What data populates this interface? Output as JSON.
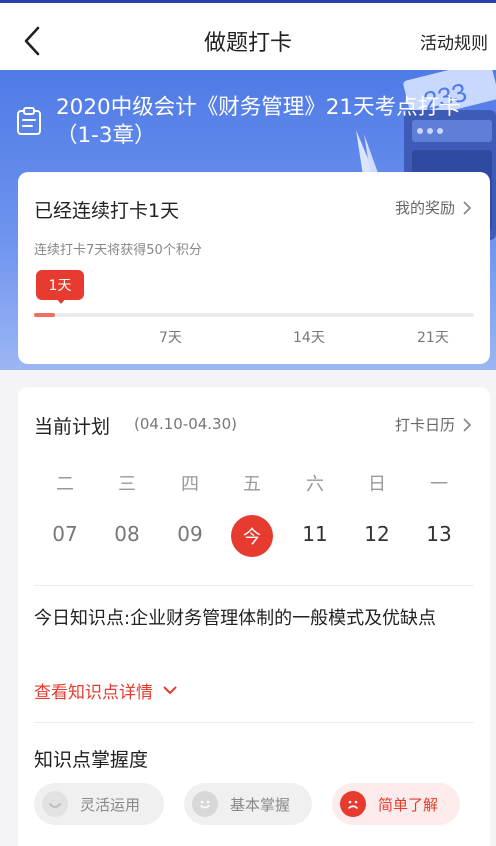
{
  "nav": {
    "title": "做题打卡",
    "rules_label": "活动规则"
  },
  "hero": {
    "title": "2020中级会计《财务管理》21天考点打卡（1-3章）",
    "decor_text": "233"
  },
  "streak": {
    "title": "已经连续打卡1天",
    "reward_label": "我的奖励",
    "subtitle": "连续打卡7天将获得50个积分",
    "badge": "1天",
    "progress_fraction": 0.048,
    "ticks": [
      "7天",
      "14天",
      "21天"
    ]
  },
  "plan": {
    "title": "当前计划",
    "range": "(04.10-04.30)",
    "calendar_label": "打卡日历",
    "weekdays": [
      "二",
      "三",
      "四",
      "五",
      "六",
      "日",
      "一"
    ],
    "dates": [
      "07",
      "08",
      "09",
      "今",
      "11",
      "12",
      "13"
    ],
    "today_index": 3,
    "knowledge_title": "今日知识点:企业财务管理体制的一般模式及优缺点",
    "detail_label": "查看知识点详情",
    "mastery_title": "知识点掌握度",
    "mastery_options": [
      {
        "label": "灵活运用",
        "selected": false,
        "icon": "smile-face-icon"
      },
      {
        "label": "基本掌握",
        "selected": false,
        "icon": "neutral-face-icon"
      },
      {
        "label": "简单了解",
        "selected": true,
        "icon": "sad-face-icon"
      }
    ]
  },
  "colors": {
    "accent": "#e63b2e",
    "hero_blue": "#4f7be6",
    "top_border": "#2b3fa8"
  }
}
